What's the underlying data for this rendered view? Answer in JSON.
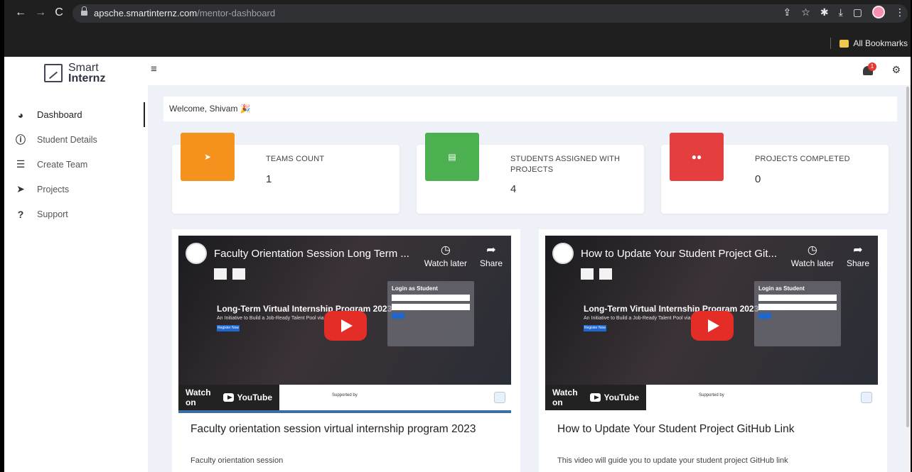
{
  "browser": {
    "url_host": "apsche.smartinternz.com",
    "url_path": "/mentor-dashboard",
    "bookmarks_label": "All Bookmarks"
  },
  "brand": {
    "line1": "Smart",
    "line2": "Internz"
  },
  "sidebar": {
    "items": [
      {
        "label": "Dashboard",
        "icon": "dashboard-icon"
      },
      {
        "label": "Student Details",
        "icon": "info-icon"
      },
      {
        "label": "Create Team",
        "icon": "list-icon"
      },
      {
        "label": "Projects",
        "icon": "send-icon"
      },
      {
        "label": "Support",
        "icon": "question-icon"
      }
    ]
  },
  "topbar": {
    "notification_count": "1"
  },
  "welcome": {
    "text": "Welcome, Shivam 🎉"
  },
  "stats": [
    {
      "label": "TEAMS COUNT",
      "value": "1",
      "color": "#f5921e"
    },
    {
      "label": "STUDENTS ASSIGNED WITH PROJECTS",
      "value": "4",
      "color": "#4caf50"
    },
    {
      "label": "PROJECTS COMPLETED",
      "value": "0",
      "color": "#e53e3e"
    }
  ],
  "videos": [
    {
      "embed_title": "Faculty Orientation Session Long Term ...",
      "title": "Faculty orientation session virtual internship program 2023",
      "description": "Faculty orientation session",
      "program_title": "Long-Term Virtual Internship Program 2023",
      "program_sub": "An Initiative to Build a Job-Ready Talent Pool via Project-B",
      "login_title": "Login as Student"
    },
    {
      "embed_title": "How to Update Your Student Project Git...",
      "title": "How to Update Your Student Project GitHub Link",
      "description": "This video will guide you to update your student project GitHub link",
      "program_title": "Long-Term Virtual Internship Program 2023",
      "program_sub": "An Initiative to Build a Job-Ready Talent Pool via Project-B",
      "login_title": "Login as Student"
    }
  ],
  "video_ui": {
    "watch_later": "Watch later",
    "share": "Share",
    "watch_on": "Watch on",
    "youtube": "YouTube",
    "supported_by": "Supported by",
    "register": "Register Now"
  }
}
